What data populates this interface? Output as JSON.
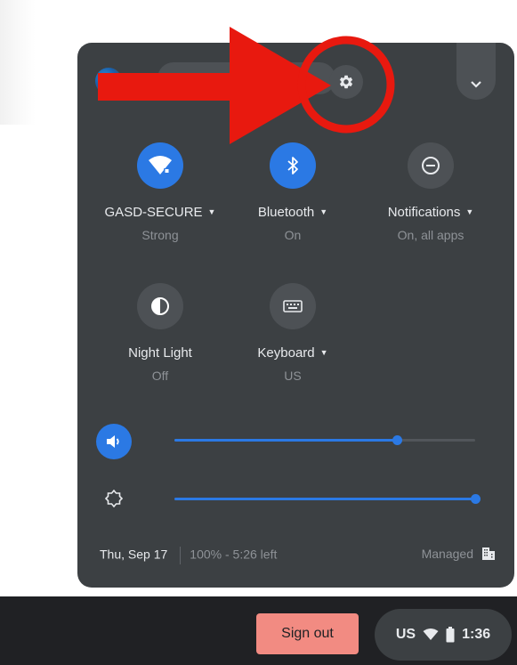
{
  "panel": {
    "network_tile": {
      "label": "GASD-SECURE",
      "sublabel": "Strong"
    },
    "bluetooth_tile": {
      "label": "Bluetooth",
      "sublabel": "On"
    },
    "notifications_tile": {
      "label": "Notifications",
      "sublabel": "On, all apps"
    },
    "night_light_tile": {
      "label": "Night Light",
      "sublabel": "Off"
    },
    "keyboard_tile": {
      "label": "Keyboard",
      "sublabel": "US"
    },
    "volume_level": 0.74,
    "brightness_level": 1.0,
    "footer": {
      "date": "Thu, Sep 17",
      "battery": "100% - 5:26 left",
      "managed_label": "Managed"
    }
  },
  "shelf": {
    "signout_label": "Sign out",
    "ime": "US",
    "time": "1:36"
  },
  "icons": [
    "settings-gear-icon",
    "chevron-down-icon",
    "wifi-icon",
    "bluetooth-icon",
    "do-not-disturb-icon",
    "night-light-icon",
    "keyboard-icon",
    "volume-icon",
    "brightness-icon",
    "enterprise-building-icon",
    "battery-icon"
  ],
  "colors": {
    "panel_bg": "#3c4043",
    "accent": "#2b79e4",
    "signout": "#f28b82",
    "annotation": "#e8190f"
  }
}
